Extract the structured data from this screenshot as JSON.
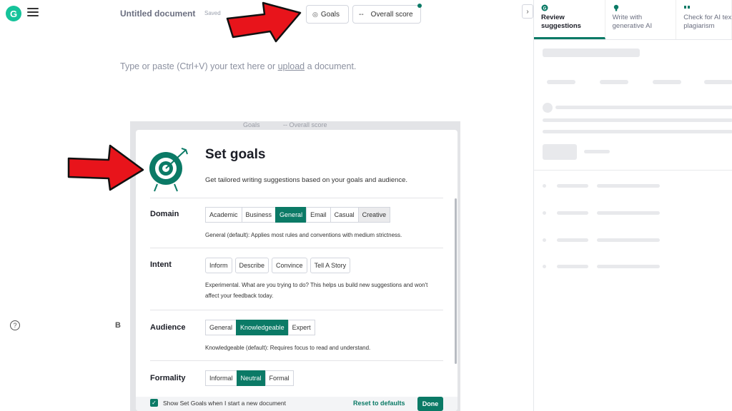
{
  "editor": {
    "logo_letter": "G",
    "doc_title": "Untitled document",
    "saved": "Saved",
    "goals_label": "Goals",
    "score_prefix": "--",
    "score_label": "Overall score",
    "placeholder_before": "Type or paste (Ctrl+V) your text here or ",
    "placeholder_link": "upload",
    "placeholder_after": " a document."
  },
  "right_panel": {
    "toggle_glyph": "›",
    "tabs": [
      {
        "label": "Review suggestions",
        "icon": "grammarly-icon"
      },
      {
        "label": "Write with generative AI",
        "icon": "bulb-icon"
      },
      {
        "label": "Check for AI text & plagiarism",
        "icon": "quote-icon"
      }
    ]
  },
  "modal": {
    "ghost_goals": "Goals",
    "ghost_score": "--    Overall score",
    "title": "Set goals",
    "subtitle": "Get tailored writing suggestions based on your goals and audience.",
    "domain": {
      "label": "Domain",
      "options": [
        "Academic",
        "Business",
        "General",
        "Email",
        "Casual",
        "Creative"
      ],
      "selected": "General",
      "description": "General (default): Applies most rules and conventions with medium strictness."
    },
    "intent": {
      "label": "Intent",
      "options": [
        "Inform",
        "Describe",
        "Convince",
        "Tell A Story"
      ],
      "description": "Experimental. What are you trying to do? This helps us build new suggestions and won't affect your feedback today."
    },
    "audience": {
      "label": "Audience",
      "options": [
        "General",
        "Knowledgeable",
        "Expert"
      ],
      "selected": "Knowledgeable",
      "description": "Knowledgeable (default): Requires focus to read and understand."
    },
    "formality": {
      "label": "Formality",
      "options": [
        "Informal",
        "Neutral",
        "Formal"
      ],
      "selected": "Neutral"
    },
    "footer": {
      "checkbox_label": "Show Set Goals when I start a new document",
      "checked": true,
      "reset_label": "Reset to defaults",
      "done_label": "Done"
    }
  },
  "colors": {
    "accent": "#0b7a66",
    "arrow": "#e8141b"
  },
  "misc": {
    "help_glyph": "?",
    "b_glyph": "B"
  }
}
